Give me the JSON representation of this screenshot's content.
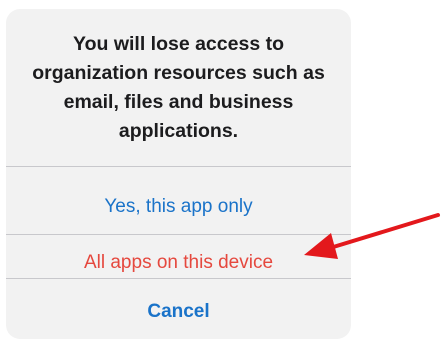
{
  "dialog": {
    "message": "You will lose access to organization resources such as email, files and business applications.",
    "actions": [
      {
        "label": "Yes, this app only",
        "style": "default"
      },
      {
        "label": "All apps on this device",
        "style": "destructive"
      },
      {
        "label": "Cancel",
        "style": "cancel"
      }
    ]
  },
  "annotation": {
    "type": "arrow",
    "color": "#e3181c",
    "points_to": "All apps on this device"
  },
  "colors": {
    "sheet_background": "#f2f2f2",
    "message_text": "#1c1c1e",
    "action_blue": "#1a73c9",
    "action_red": "#e5483e",
    "separator": "#c8c8cc"
  }
}
